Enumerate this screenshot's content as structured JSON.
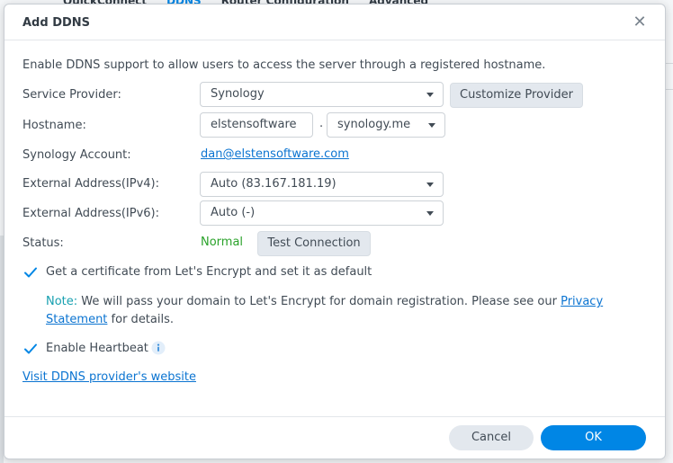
{
  "background": {
    "tabs": [
      "QuickConnect",
      "DDNS",
      "Router Configuration",
      "Advanced"
    ],
    "active_tab": "DDNS"
  },
  "dialog": {
    "title": "Add DDNS",
    "description": "Enable DDNS support to allow users to access the server through a registered hostname.",
    "service_provider": {
      "label": "Service Provider:",
      "value": "Synology",
      "customize_button": "Customize Provider"
    },
    "hostname": {
      "label": "Hostname:",
      "value": "elstensoftware",
      "separator": ".",
      "domain": "synology.me"
    },
    "account": {
      "label": "Synology Account:",
      "value": "dan@elstensoftware.com"
    },
    "ipv4": {
      "label": "External Address(IPv4):",
      "value": "Auto (83.167.181.19)"
    },
    "ipv6": {
      "label": "External Address(IPv6):",
      "value": "Auto (-)"
    },
    "status": {
      "label": "Status:",
      "value": "Normal",
      "test_button": "Test Connection"
    },
    "certificate": {
      "checked": true,
      "label": "Get a certificate from Let's Encrypt and set it as default"
    },
    "note": {
      "label": "Note:",
      "text": " We will pass your domain to Let's Encrypt for domain registration. Please see our ",
      "link": "Privacy Statement",
      "suffix": " for details."
    },
    "heartbeat": {
      "checked": true,
      "label": "Enable Heartbeat"
    },
    "provider_link": "Visit DDNS provider's website",
    "cancel_label": "Cancel",
    "ok_label": "OK"
  },
  "colors": {
    "accent": "#0086e5",
    "status_ok": "#2aa22a",
    "note_label": "#18a0b0",
    "link": "#0b74d1"
  }
}
